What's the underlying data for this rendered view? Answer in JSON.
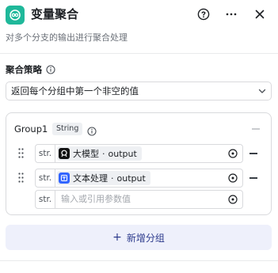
{
  "header": {
    "title": "变量聚合",
    "subtitle": "对多个分支的输出进行聚合处理",
    "accent_color": "#1fb89a",
    "help_icon": "question-circle-icon",
    "more_icon": "more-horizontal-icon",
    "close_icon": "close-icon"
  },
  "strategy": {
    "label": "聚合策略",
    "value": "返回每个分组中第一个非空的值"
  },
  "group": {
    "name": "Group1",
    "type": "String",
    "variables": [
      {
        "tag": "str.",
        "source": "大模型",
        "separator": " · ",
        "field": "output",
        "icon": "llm-icon",
        "icon_color": "#111111"
      },
      {
        "tag": "str.",
        "source": "文本处理",
        "separator": " · ",
        "field": "output",
        "icon": "text-process-icon",
        "icon_color": "#3366ff"
      }
    ],
    "empty_row": {
      "tag": "str.",
      "placeholder": "输入或引用参数值"
    }
  },
  "add_group": {
    "plus": "+",
    "label": "新增分组"
  }
}
